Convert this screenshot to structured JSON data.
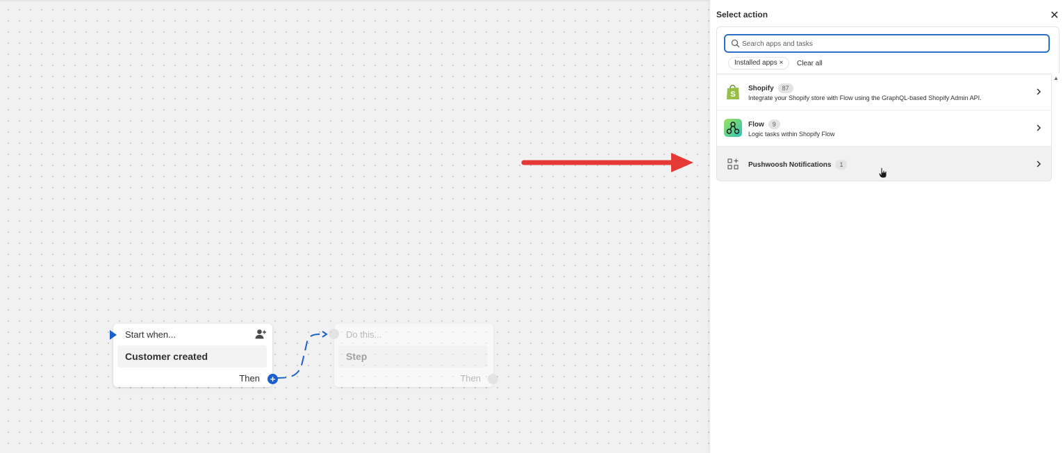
{
  "canvas": {
    "trigger_node": {
      "header": "Start when...",
      "title": "Customer created",
      "footer": "Then",
      "icon": "user-plus-icon"
    },
    "action_node": {
      "header": "Do this...",
      "title": "Step",
      "footer": "Then"
    },
    "annotation_arrow_color": "#e53935"
  },
  "panel": {
    "title": "Select action",
    "close_icon": "close-icon",
    "search": {
      "placeholder": "Search apps and tasks",
      "value": ""
    },
    "filters": {
      "chip_label": "Installed apps ×",
      "clear_label": "Clear all"
    },
    "apps": [
      {
        "name": "Shopify",
        "count": "87",
        "description": "Integrate your Shopify store with Flow using the GraphQL-based Shopify Admin API.",
        "icon": "shopify-bag-icon"
      },
      {
        "name": "Flow",
        "count": "9",
        "description": "Logic tasks within Shopify Flow",
        "icon": "flow-icon"
      },
      {
        "name": "Pushwoosh Notifications",
        "count": "1",
        "description": "",
        "icon": "apps-grid-icon"
      }
    ]
  },
  "colors": {
    "accent": "#1a5fd0",
    "focus_ring": "#2c6ecb",
    "shopify_green": "#95bf47"
  }
}
